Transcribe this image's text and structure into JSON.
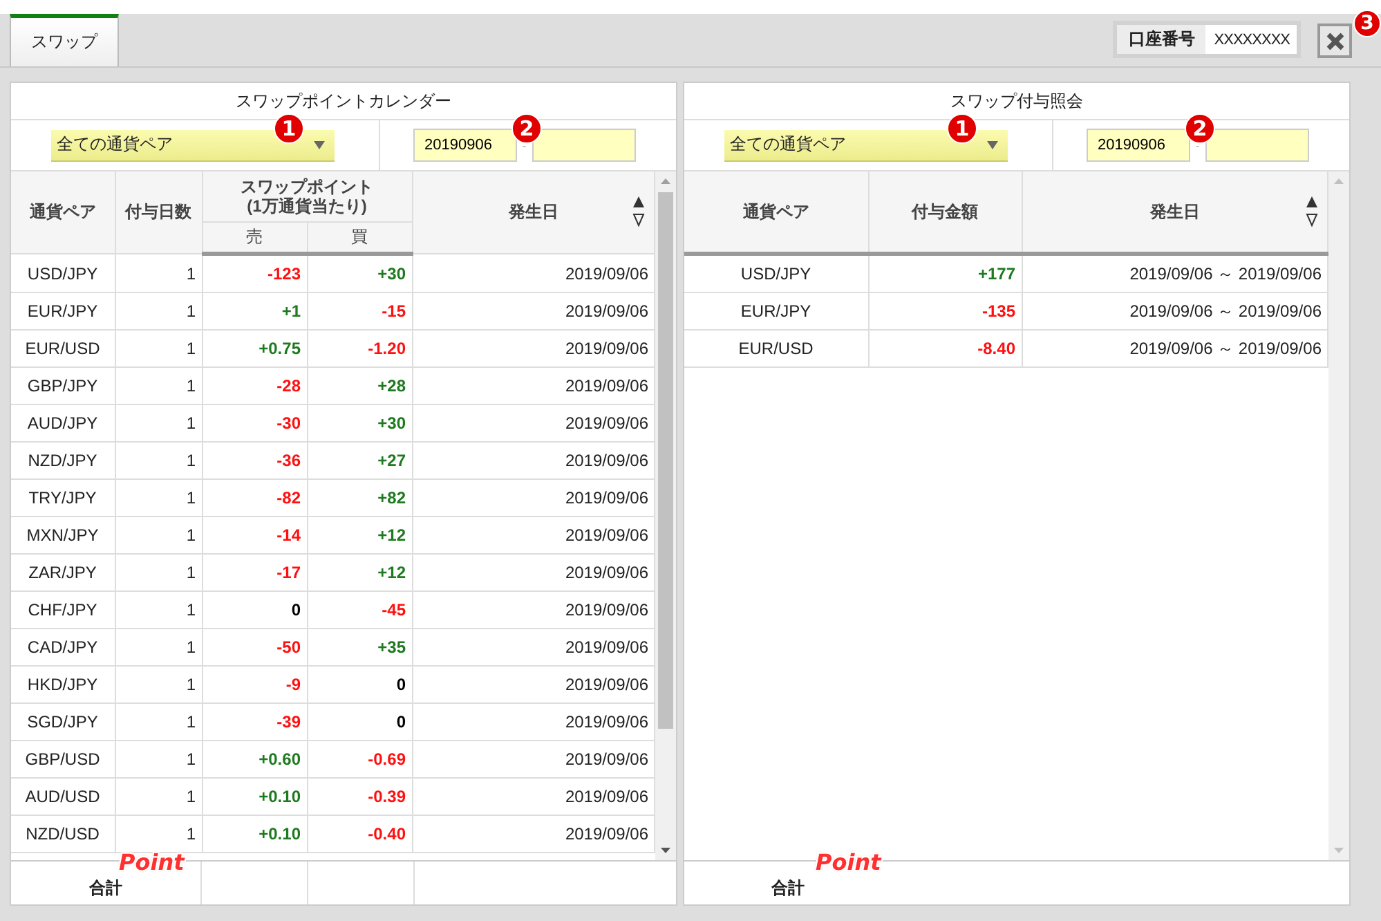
{
  "tabs": [
    {
      "label": "スワップ",
      "selected": true
    }
  ],
  "account": {
    "label": "口座番号",
    "value": "XXXXXXXX"
  },
  "close_marker": "3",
  "calendar": {
    "title": "スワップポイントカレンダー",
    "select": {
      "value": "全ての通貨ペア",
      "marker": "1"
    },
    "date_from": {
      "value": "20190906"
    },
    "date_separator": "-",
    "date_marker": "2",
    "columns": {
      "pair": "通貨ペア",
      "days": "付与日数",
      "points": "スワップポイント",
      "points_note": "(1万通貨当たり)",
      "sell": "売",
      "buy": "買",
      "date": "発生日"
    },
    "rows": [
      {
        "pair": "USD/JPY",
        "days": "1",
        "sell": {
          "text": "-123",
          "color": "#ff1010"
        },
        "buy": {
          "text": "+30",
          "color": "#1e7a1e"
        },
        "date": "2019/09/06"
      },
      {
        "pair": "EUR/JPY",
        "days": "1",
        "sell": {
          "text": "+1",
          "color": "#1e7a1e"
        },
        "buy": {
          "text": "-15",
          "color": "#ff1010"
        },
        "date": "2019/09/06"
      },
      {
        "pair": "EUR/USD",
        "days": "1",
        "sell": {
          "text": "+0.75",
          "color": "#1e7a1e"
        },
        "buy": {
          "text": "-1.20",
          "color": "#ff1010"
        },
        "date": "2019/09/06"
      },
      {
        "pair": "GBP/JPY",
        "days": "1",
        "sell": {
          "text": "-28",
          "color": "#ff1010"
        },
        "buy": {
          "text": "+28",
          "color": "#1e7a1e"
        },
        "date": "2019/09/06"
      },
      {
        "pair": "AUD/JPY",
        "days": "1",
        "sell": {
          "text": "-30",
          "color": "#ff1010"
        },
        "buy": {
          "text": "+30",
          "color": "#1e7a1e"
        },
        "date": "2019/09/06"
      },
      {
        "pair": "NZD/JPY",
        "days": "1",
        "sell": {
          "text": "-36",
          "color": "#ff1010"
        },
        "buy": {
          "text": "+27",
          "color": "#1e7a1e"
        },
        "date": "2019/09/06"
      },
      {
        "pair": "TRY/JPY",
        "days": "1",
        "sell": {
          "text": "-82",
          "color": "#ff1010"
        },
        "buy": {
          "text": "+82",
          "color": "#1e7a1e"
        },
        "date": "2019/09/06"
      },
      {
        "pair": "MXN/JPY",
        "days": "1",
        "sell": {
          "text": "-14",
          "color": "#ff1010"
        },
        "buy": {
          "text": "+12",
          "color": "#1e7a1e"
        },
        "date": "2019/09/06"
      },
      {
        "pair": "ZAR/JPY",
        "days": "1",
        "sell": {
          "text": "-17",
          "color": "#ff1010"
        },
        "buy": {
          "text": "+12",
          "color": "#1e7a1e"
        },
        "date": "2019/09/06"
      },
      {
        "pair": "CHF/JPY",
        "days": "1",
        "sell": {
          "text": "0",
          "color": "#000000"
        },
        "buy": {
          "text": "-45",
          "color": "#ff1010"
        },
        "date": "2019/09/06"
      },
      {
        "pair": "CAD/JPY",
        "days": "1",
        "sell": {
          "text": "-50",
          "color": "#ff1010"
        },
        "buy": {
          "text": "+35",
          "color": "#1e7a1e"
        },
        "date": "2019/09/06"
      },
      {
        "pair": "HKD/JPY",
        "days": "1",
        "sell": {
          "text": "-9",
          "color": "#ff1010"
        },
        "buy": {
          "text": "0",
          "color": "#000000"
        },
        "date": "2019/09/06"
      },
      {
        "pair": "SGD/JPY",
        "days": "1",
        "sell": {
          "text": "-39",
          "color": "#ff1010"
        },
        "buy": {
          "text": "0",
          "color": "#000000"
        },
        "date": "2019/09/06"
      },
      {
        "pair": "GBP/USD",
        "days": "1",
        "sell": {
          "text": "+0.60",
          "color": "#1e7a1e"
        },
        "buy": {
          "text": "-0.69",
          "color": "#ff1010"
        },
        "date": "2019/09/06"
      },
      {
        "pair": "AUD/USD",
        "days": "1",
        "sell": {
          "text": "+0.10",
          "color": "#1e7a1e"
        },
        "buy": {
          "text": "-0.39",
          "color": "#ff1010"
        },
        "date": "2019/09/06"
      },
      {
        "pair": "NZD/USD",
        "days": "1",
        "sell": {
          "text": "+0.10",
          "color": "#1e7a1e"
        },
        "buy": {
          "text": "-0.40",
          "color": "#ff1010"
        },
        "date": "2019/09/06"
      }
    ],
    "footer": {
      "label": "合計",
      "marker": "Point"
    }
  },
  "history": {
    "title": "スワップ付与照会",
    "select": {
      "value": "全ての通貨ペア",
      "marker": "1"
    },
    "date_from": {
      "value": "20190906"
    },
    "date_separator": "-",
    "date_marker": "2",
    "columns": {
      "pair": "通貨ペア",
      "amount": "付与金額",
      "date": "発生日"
    },
    "rows": [
      {
        "pair": "USD/JPY",
        "amount": {
          "text": "+177",
          "color": "#1e7a1e"
        },
        "date": "2019/09/06 ～ 2019/09/06"
      },
      {
        "pair": "EUR/JPY",
        "amount": {
          "text": "-135",
          "color": "#ff1010"
        },
        "date": "2019/09/06 ～ 2019/09/06"
      },
      {
        "pair": "EUR/USD",
        "amount": {
          "text": "-8.40",
          "color": "#ff1010"
        },
        "date": "2019/09/06 ～ 2019/09/06"
      }
    ],
    "footer": {
      "label": "合計",
      "marker": "Point"
    }
  }
}
